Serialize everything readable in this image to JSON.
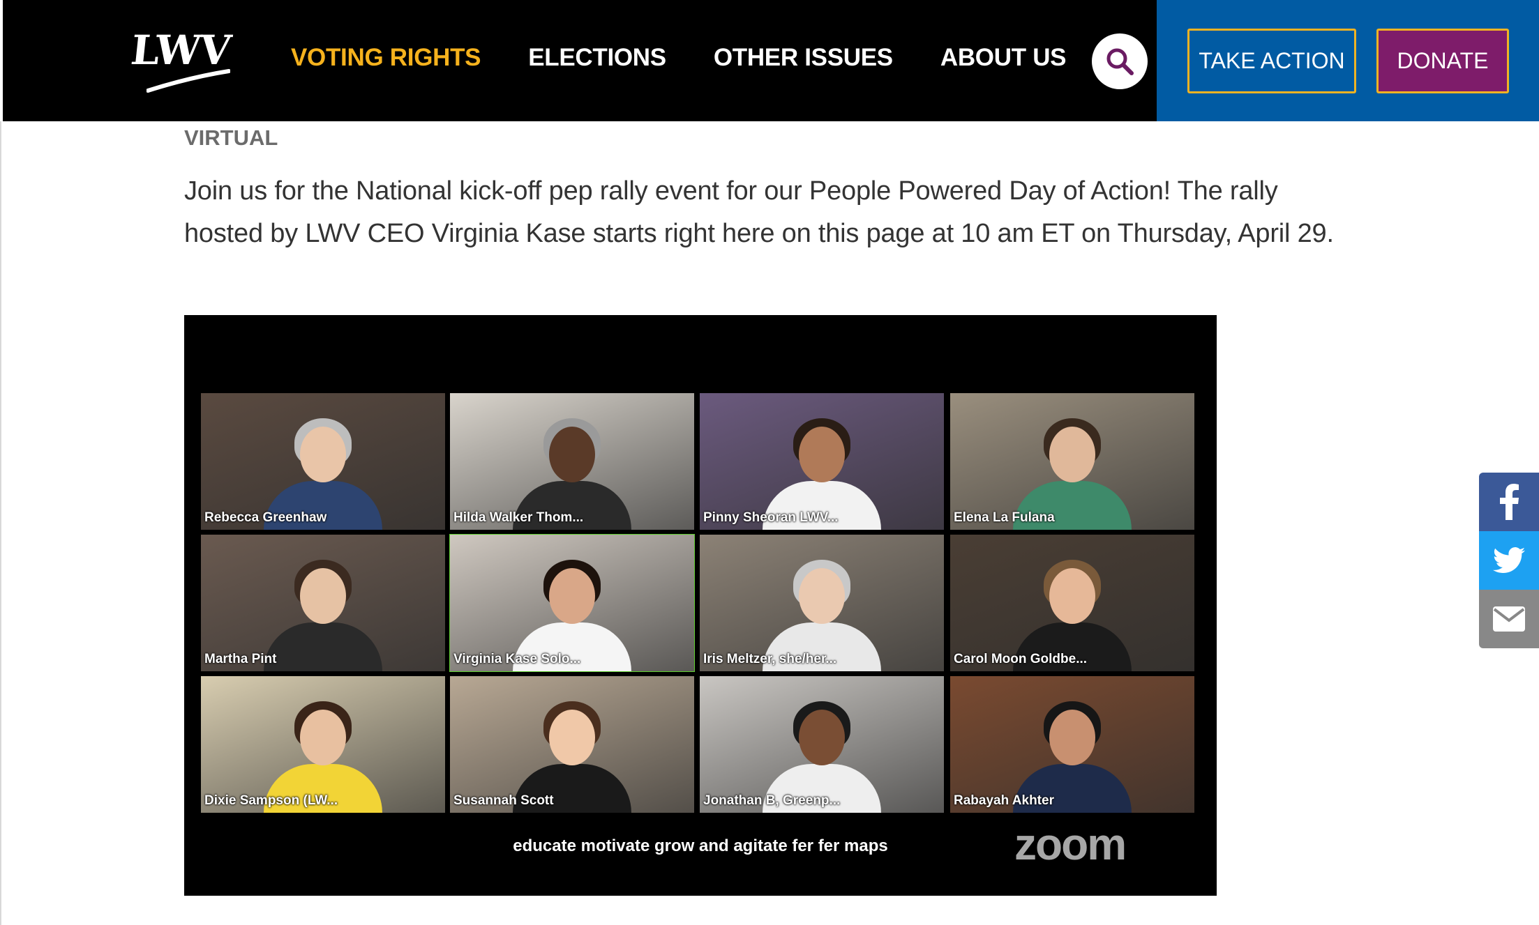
{
  "header": {
    "logo_text": "LWV",
    "nav": [
      {
        "label": "VOTING RIGHTS",
        "active": true
      },
      {
        "label": "ELECTIONS",
        "active": false
      },
      {
        "label": "OTHER ISSUES",
        "active": false
      },
      {
        "label": "ABOUT US",
        "active": false
      }
    ],
    "search_icon": "search-icon",
    "take_action_label": "TAKE ACTION",
    "donate_label": "DONATE"
  },
  "content": {
    "label": "VIRTUAL",
    "intro": "Join us for the National kick-off pep rally event for our People Powered Day of Action! The rally hosted by LWV CEO Virginia Kase starts right here on this page at 10 am ET on Thursday, April 29."
  },
  "video": {
    "participants": [
      {
        "name": "Rebecca Greenhaw",
        "speaking": false
      },
      {
        "name": "Hilda Walker Thom...",
        "speaking": false
      },
      {
        "name": "Pinny Sheoran LWV...",
        "speaking": false
      },
      {
        "name": "Elena La Fulana",
        "speaking": false
      },
      {
        "name": "Martha Pint",
        "speaking": false
      },
      {
        "name": "Virginia Kase Solo...",
        "speaking": true
      },
      {
        "name": "Iris Meltzer, she/her...",
        "speaking": false
      },
      {
        "name": "Carol Moon Goldbe...",
        "speaking": false
      },
      {
        "name": "Dixie Sampson (LW...",
        "speaking": false
      },
      {
        "name": "Susannah Scott",
        "speaking": false
      },
      {
        "name": "Jonathan B, Greenp...",
        "speaking": false
      },
      {
        "name": "Rabayah Akhter",
        "speaking": false
      }
    ],
    "caption": "educate motivate grow and agitate fer fer maps",
    "watermark": "zoom"
  },
  "share": {
    "icons": [
      "facebook-icon",
      "twitter-icon",
      "email-icon"
    ]
  },
  "colors": {
    "header_bg": "#000000",
    "nav_active": "#f6b21d",
    "cta_panel": "#015ba3",
    "cta_border": "#f0b323",
    "donate_bg": "#7e1c6a",
    "speaker_outline": "#5fcf2e",
    "facebook": "#3b5998",
    "twitter": "#1da1f2",
    "email": "#888888"
  }
}
